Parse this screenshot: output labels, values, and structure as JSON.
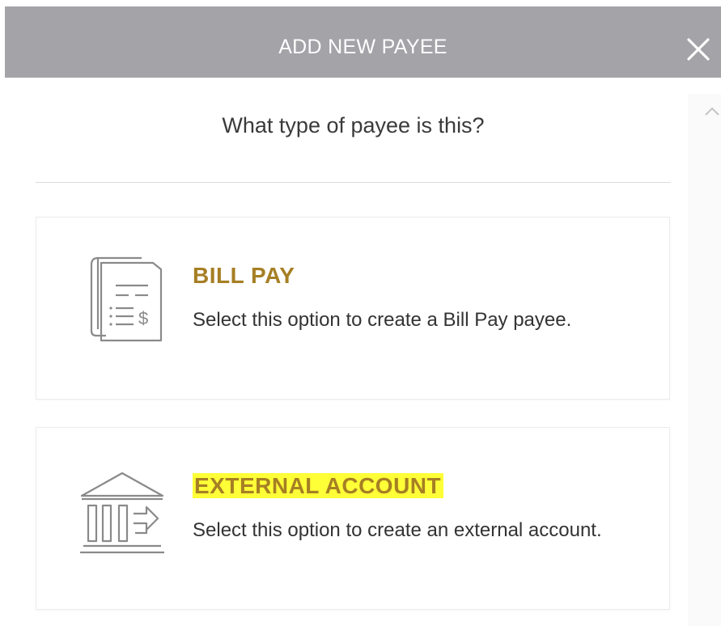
{
  "dialog": {
    "title": "ADD NEW PAYEE",
    "close_icon": "close-icon"
  },
  "prompt": {
    "question": "What type of payee is this?"
  },
  "options": [
    {
      "title": "BILL PAY",
      "description": "Select this option to create a Bill Pay payee.",
      "icon": "bill-document-icon"
    },
    {
      "title": "EXTERNAL ACCOUNT",
      "description": "Select this option to create an external account.",
      "icon": "bank-transfer-icon",
      "title_highlighted": true
    }
  ],
  "colors": {
    "header_bg": "#a3a3a8",
    "option_title": "#a67f24",
    "highlight": "#ffff37",
    "icon_stroke": "#8a8a8a"
  }
}
